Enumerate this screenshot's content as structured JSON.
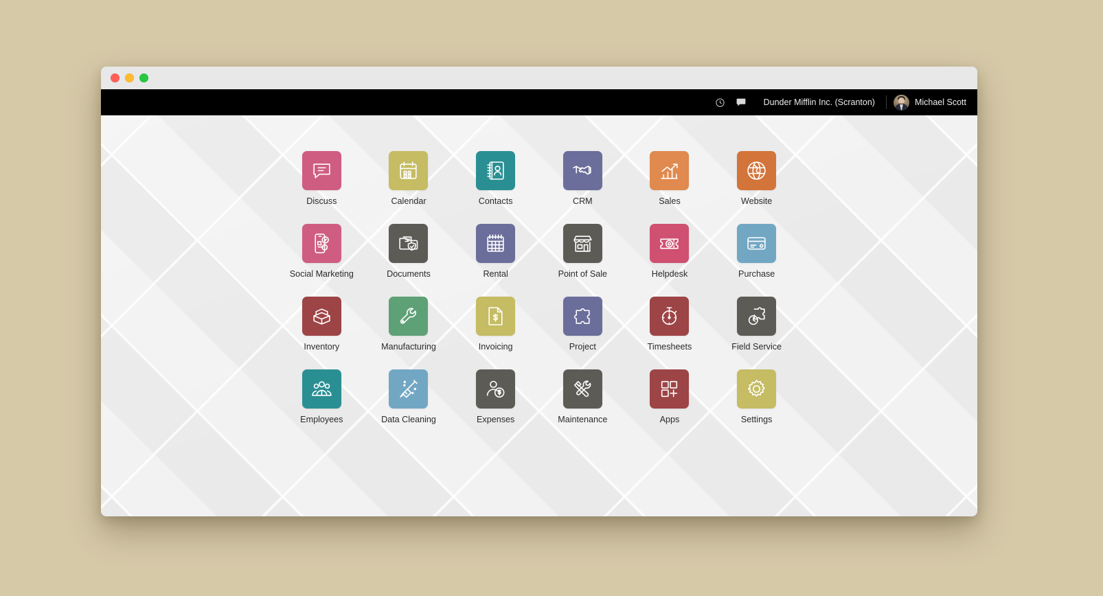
{
  "window": {
    "traffic_lights": [
      {
        "name": "close",
        "color": "#ff5f57"
      },
      {
        "name": "minimize",
        "color": "#febc2e"
      },
      {
        "name": "maximize",
        "color": "#28c840"
      }
    ],
    "titlebar_color": "#e8e8e8",
    "background_color": "#d6c9a8"
  },
  "navbar": {
    "background_color": "#000000",
    "activity_icon": "clock-icon",
    "messaging_icon": "chat-bubble-icon",
    "company_name": "Dunder Mifflin Inc. (Scranton)",
    "user_name": "Michael Scott",
    "avatar_icon": "user-avatar"
  },
  "home": {
    "apps": [
      {
        "label": "Discuss",
        "icon": "discuss-icon",
        "color": "#cf5d82"
      },
      {
        "label": "Calendar",
        "icon": "calendar-icon",
        "color": "#c5bc63"
      },
      {
        "label": "Contacts",
        "icon": "contacts-icon",
        "color": "#2a8f93"
      },
      {
        "label": "CRM",
        "icon": "handshake-icon",
        "color": "#6b6e9b"
      },
      {
        "label": "Sales",
        "icon": "bar-chart-arrow-icon",
        "color": "#e08a4f"
      },
      {
        "label": "Website",
        "icon": "globe-icon",
        "color": "#d3743a"
      },
      {
        "label": "Social Marketing",
        "icon": "social-phone-icon",
        "color": "#cf5d82"
      },
      {
        "label": "Documents",
        "icon": "document-shield-icon",
        "color": "#5d5b56"
      },
      {
        "label": "Rental",
        "icon": "grid-calendar-icon",
        "color": "#6b6e9b"
      },
      {
        "label": "Point of Sale",
        "icon": "storefront-icon",
        "color": "#5d5b56"
      },
      {
        "label": "Helpdesk",
        "icon": "ticket-icon",
        "color": "#cf5070"
      },
      {
        "label": "Purchase",
        "icon": "credit-card-icon",
        "color": "#72a7c4"
      },
      {
        "label": "Inventory",
        "icon": "open-box-icon",
        "color": "#9d4446"
      },
      {
        "label": "Manufacturing",
        "icon": "wrench-icon",
        "color": "#5ea177"
      },
      {
        "label": "Invoicing",
        "icon": "invoice-dollar-icon",
        "color": "#c5bc63"
      },
      {
        "label": "Project",
        "icon": "puzzle-icon",
        "color": "#6b6e9b"
      },
      {
        "label": "Timesheets",
        "icon": "stopwatch-icon",
        "color": "#9d4446"
      },
      {
        "label": "Field Service",
        "icon": "puzzle-clock-icon",
        "color": "#5d5b56"
      },
      {
        "label": "Employees",
        "icon": "people-group-icon",
        "color": "#2a8f93"
      },
      {
        "label": "Data Cleaning",
        "icon": "broom-sparkle-icon",
        "color": "#72a7c4"
      },
      {
        "label": "Expenses",
        "icon": "person-dollar-icon",
        "color": "#5d5b56"
      },
      {
        "label": "Maintenance",
        "icon": "hammer-wrench-icon",
        "color": "#5d5b56"
      },
      {
        "label": "Apps",
        "icon": "apps-plus-icon",
        "color": "#9d4446"
      },
      {
        "label": "Settings",
        "icon": "gear-icon",
        "color": "#c5bc63"
      }
    ]
  }
}
